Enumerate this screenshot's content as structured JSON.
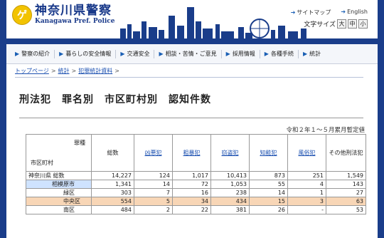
{
  "header": {
    "logo_mark": "ゲ",
    "logo_jp": "神奈川県警察",
    "logo_en": "Kanagawa Pref. Police",
    "links": [
      "サイトマップ",
      "English"
    ],
    "font_size_label": "文字サイズ",
    "font_sizes": [
      "大",
      "中",
      "小"
    ]
  },
  "nav": [
    "警察の紹介",
    "暮らしの安全情報",
    "交通安全",
    "相談・苦情・ご意見",
    "採用情報",
    "各種手続",
    "統計"
  ],
  "breadcrumb": [
    "トップページ",
    "統計",
    "犯罪統計資料"
  ],
  "page_title": "刑法犯　罪名別　市区町村別　認知件数",
  "note": "令和２年１～５月累月暫定値",
  "table": {
    "corner_top": "罪種",
    "corner_bottom": "市区町村",
    "headers": [
      "総数",
      "凶悪犯",
      "粗暴犯",
      "窃盗犯",
      "知能犯",
      "風俗犯",
      "その他刑法犯"
    ],
    "rows": [
      {
        "name": "神奈川県 総数",
        "values": [
          "14,227",
          "124",
          "1,017",
          "10,413",
          "873",
          "251",
          "1,549"
        ]
      },
      {
        "name": "相模原市",
        "values": [
          "1,341",
          "14",
          "72",
          "1,053",
          "55",
          "4",
          "143"
        ]
      },
      {
        "name": "緑区",
        "values": [
          "303",
          "7",
          "16",
          "238",
          "14",
          "1",
          "27"
        ]
      },
      {
        "name": "中央区",
        "values": [
          "554",
          "5",
          "34",
          "434",
          "15",
          "3",
          "63"
        ]
      },
      {
        "name": "南区",
        "values": [
          "484",
          "2",
          "22",
          "381",
          "26",
          "-",
          "53"
        ]
      }
    ]
  }
}
